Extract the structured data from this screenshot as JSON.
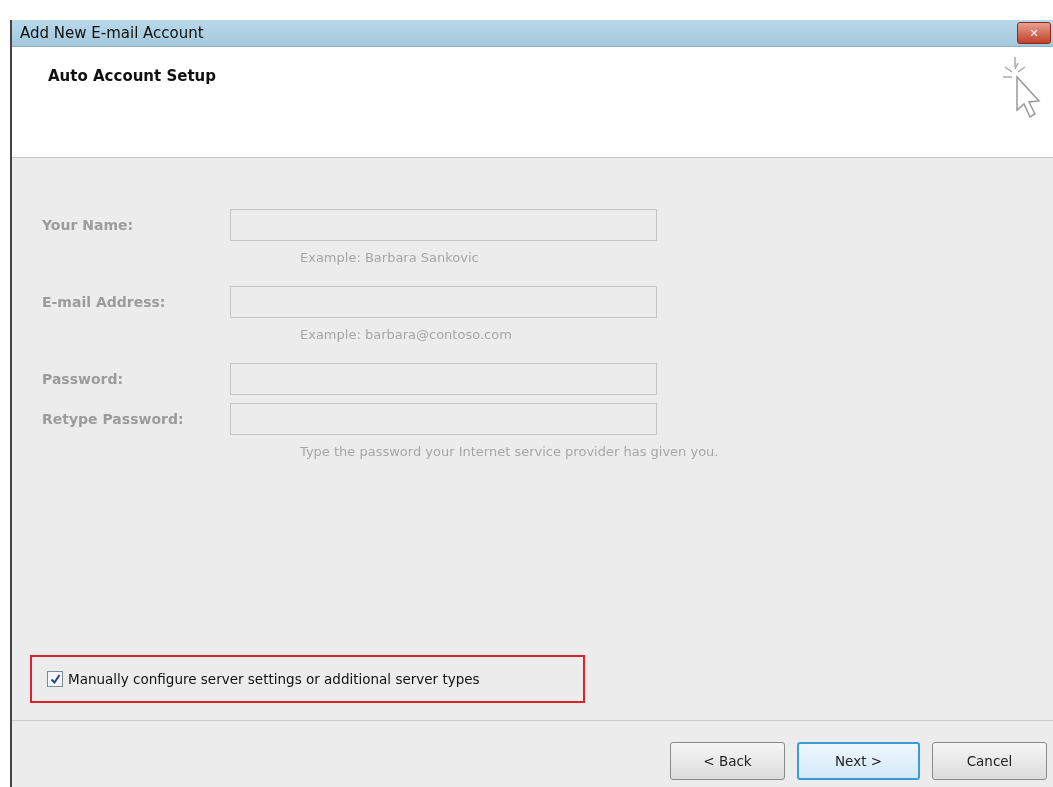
{
  "window": {
    "title": "Add New E-mail Account",
    "close_label": "✕"
  },
  "header": {
    "title": "Auto Account Setup"
  },
  "fields": [
    {
      "label": "Your Name:",
      "hint": "Example: Barbara Sankovic",
      "disabled": true
    },
    {
      "label": "E-mail Address:",
      "hint": "Example: barbara@contoso.com",
      "disabled": true
    },
    {
      "label": "Password:",
      "disabled": true
    },
    {
      "label": "Retype Password:",
      "hint": "Type the password your Internet service provider has given you.",
      "disabled": true
    }
  ],
  "manual_config": {
    "label": "Manually configure server settings or additional server types",
    "checked": true,
    "highlighted": true
  },
  "buttons": [
    {
      "label": "< Back",
      "default": false
    },
    {
      "label": "Next >",
      "default": true
    },
    {
      "label": "Cancel",
      "default": false
    }
  ]
}
